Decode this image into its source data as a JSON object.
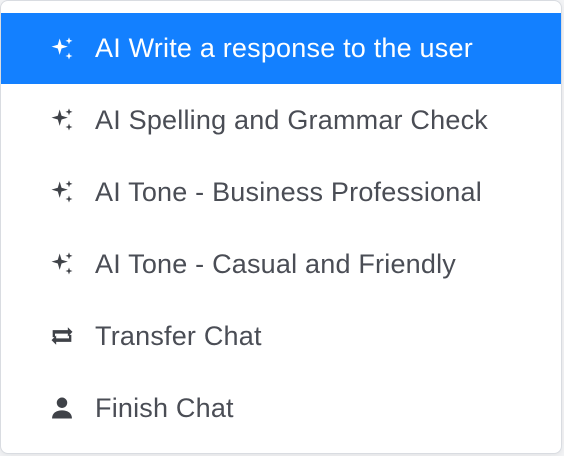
{
  "menu": {
    "items": [
      {
        "label": "AI Write a response to the user",
        "icon": "sparkle-icon",
        "active": true
      },
      {
        "label": "AI Spelling and Grammar Check",
        "icon": "sparkle-icon",
        "active": false
      },
      {
        "label": "AI Tone - Business Professional",
        "icon": "sparkle-icon",
        "active": false
      },
      {
        "label": "AI Tone - Casual and Friendly",
        "icon": "sparkle-icon",
        "active": false
      },
      {
        "label": "Transfer Chat",
        "icon": "transfer-icon",
        "active": false
      },
      {
        "label": "Finish Chat",
        "icon": "person-icon",
        "active": false
      }
    ]
  },
  "colors": {
    "active_background": "#1380ff",
    "active_text": "#ffffff",
    "text": "#4a4d55",
    "icon": "#3f4248"
  }
}
